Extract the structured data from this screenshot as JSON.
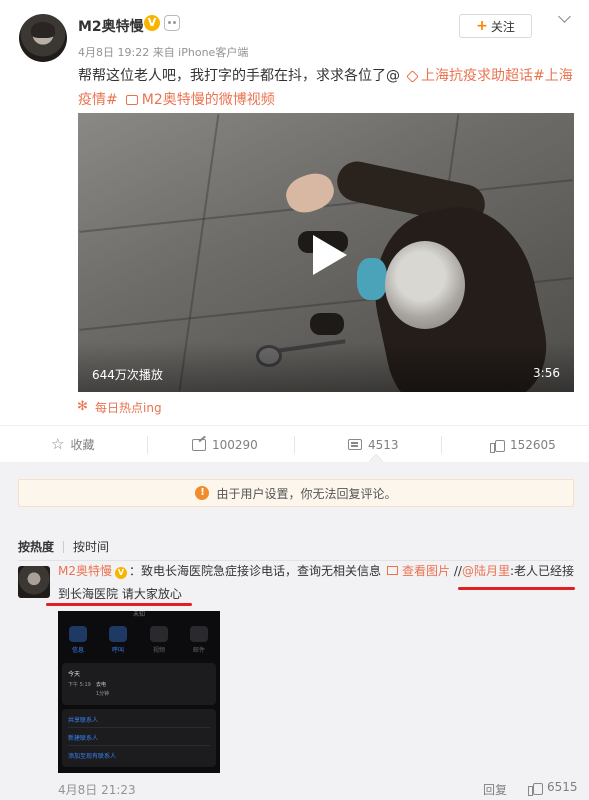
{
  "post": {
    "username": "M2奥特慢",
    "vip_badge": "V",
    "meta": "4月8日 19:22 来自 iPhone客户端",
    "follow_label": "关注",
    "follow_plus": "+",
    "text": {
      "main": "帮帮这位老人吧，我打字的手都在抖，求求各位了@",
      "topic": "上海抗疫求助超话",
      "hashtag_pre": "#上海",
      "hashtag_post": "疫情#",
      "video_link": "M2奥特慢的微博视频"
    },
    "video": {
      "view_count": "644万次播放",
      "duration": "3:56"
    },
    "hot_tag": "每日热点ing"
  },
  "actions": {
    "favorite_label": "收藏",
    "share_count": "100290",
    "comment_count": "4513",
    "like_count": "152605"
  },
  "comments": {
    "notice": "由于用户设置，你无法回复评论。",
    "sort_hot": "按热度",
    "sort_time": "按时间",
    "items": [
      {
        "username": "M2奥特慢",
        "vip_badge": "V",
        "text_part1": "：致电长海医院急症接诊电话，查询无相关信息",
        "view_pic": "查看图片",
        "repost_prefix": "//",
        "at_user": "@陆月里",
        "repost_text": ":老人已经接",
        "line2": "到长海医院 请大家放心",
        "time": "4月8日 21:23",
        "reply_label": "回复",
        "like_count": "6515",
        "phone_screenshot": {
          "top_label": "未知",
          "buttons": [
            "信息",
            "呼叫",
            "视频",
            "邮件"
          ],
          "card_title": "今天",
          "call_time": "下午 5:19",
          "call_type": "去电",
          "call_duration": "1分钟",
          "links": [
            "共享联系人",
            "新建联系人",
            "添加至现有联系人"
          ]
        }
      }
    ]
  }
}
